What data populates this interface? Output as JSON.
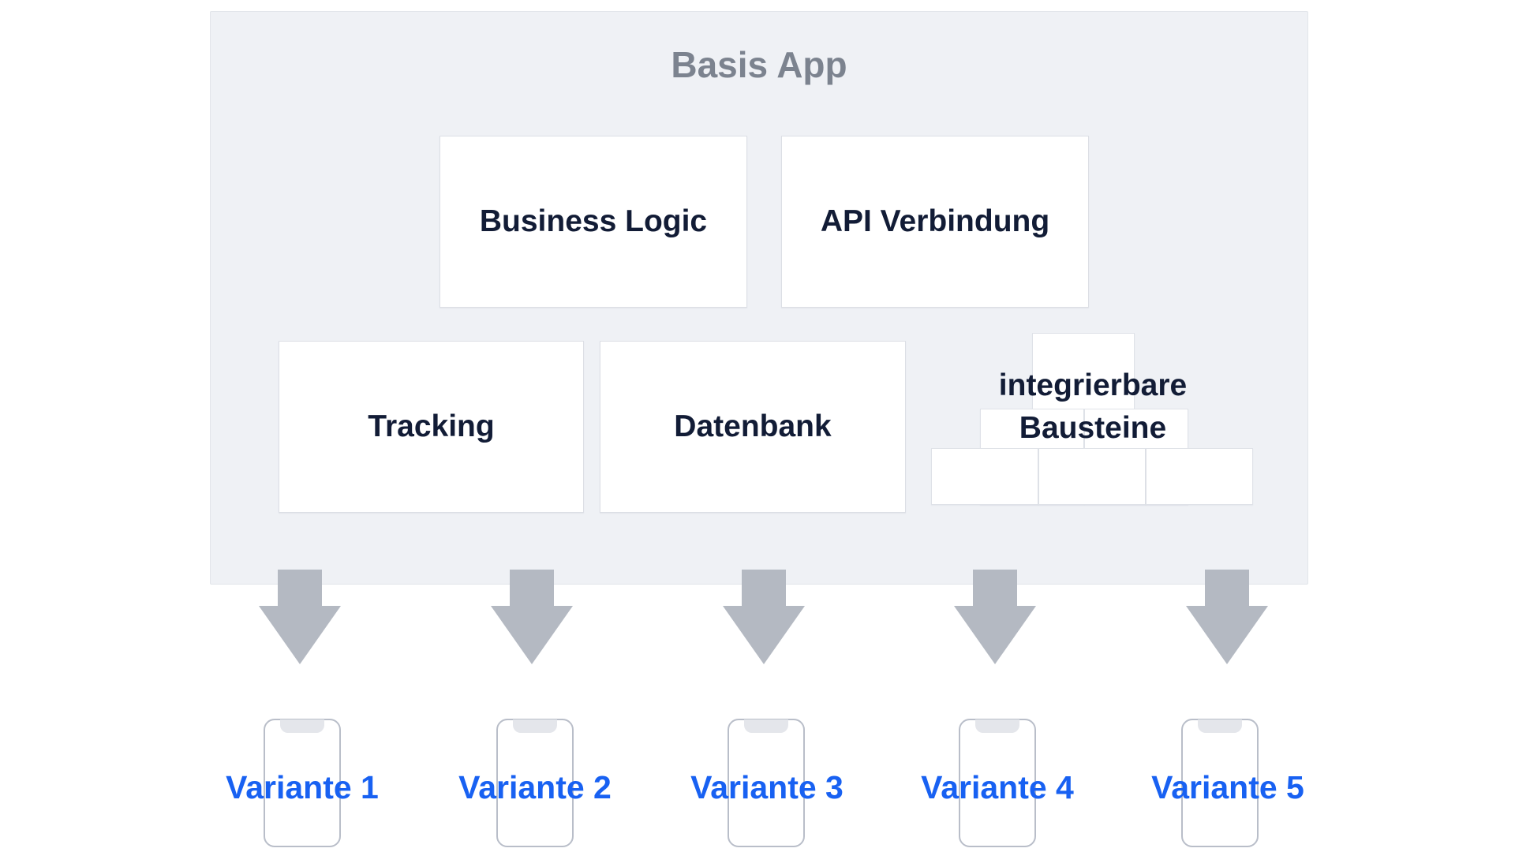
{
  "diagram": {
    "title": "Basis App",
    "title_color": "#7c838f",
    "panel_bg": "#eff1f5",
    "accent_blue": "#1861f2",
    "box_text_color": "#121c36",
    "arrow_color": "#b4b9c2"
  },
  "features": [
    {
      "id": "business-logic",
      "label": "Business Logic"
    },
    {
      "id": "api-verbindung",
      "label": "API Verbindung"
    },
    {
      "id": "tracking",
      "label": "Tracking"
    },
    {
      "id": "datenbank",
      "label": "Datenbank"
    }
  ],
  "blocks_group": {
    "label_line1": "integrierbare",
    "label_line2": "Bausteine",
    "block_count": 6
  },
  "arrows": {
    "count": 5,
    "direction": "down",
    "label": "flows-to"
  },
  "variants": [
    {
      "id": "variante-1",
      "label": "Variante 1",
      "device": "phone"
    },
    {
      "id": "variante-2",
      "label": "Variante 2",
      "device": "phone"
    },
    {
      "id": "variante-3",
      "label": "Variante 3",
      "device": "phone"
    },
    {
      "id": "variante-4",
      "label": "Variante 4",
      "device": "phone"
    },
    {
      "id": "variante-5",
      "label": "Variante 5",
      "device": "phone"
    }
  ],
  "chart_data": {
    "type": "diagram",
    "title": "Basis App",
    "nodes": [
      "Business Logic",
      "API Verbindung",
      "Tracking",
      "Datenbank",
      "integrierbare Bausteine",
      "Variante 1",
      "Variante 2",
      "Variante 3",
      "Variante 4",
      "Variante 5"
    ],
    "edges": [
      {
        "from": "Basis App",
        "to": "Variante 1"
      },
      {
        "from": "Basis App",
        "to": "Variante 2"
      },
      {
        "from": "Basis App",
        "to": "Variante 3"
      },
      {
        "from": "Basis App",
        "to": "Variante 4"
      },
      {
        "from": "Basis App",
        "to": "Variante 5"
      }
    ]
  }
}
